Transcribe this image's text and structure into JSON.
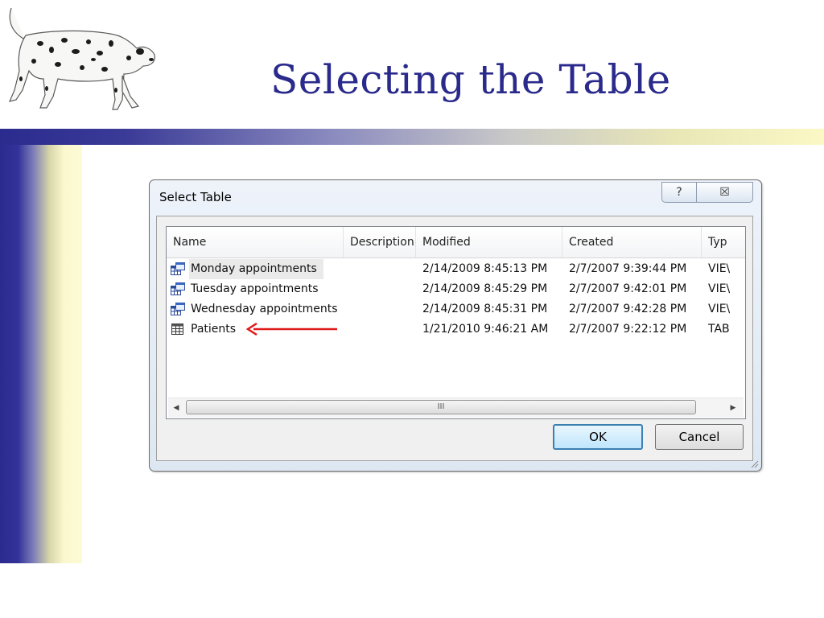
{
  "slide": {
    "title": "Selecting the Table"
  },
  "dialog": {
    "title": "Select Table",
    "help_glyph": "?",
    "close_glyph": "☒",
    "columns": [
      "Name",
      "Description",
      "Modified",
      "Created",
      "Typ"
    ],
    "rows": [
      {
        "name": "Monday appointments",
        "description": "",
        "modified": "2/14/2009 8:45:13 PM",
        "created": "2/7/2007 9:39:44 PM",
        "type": "VIE\\",
        "icon": "view-table-icon"
      },
      {
        "name": "Tuesday appointments",
        "description": "",
        "modified": "2/14/2009 8:45:29 PM",
        "created": "2/7/2007 9:42:01 PM",
        "type": "VIE\\",
        "icon": "view-table-icon"
      },
      {
        "name": "Wednesday appointments",
        "description": "",
        "modified": "2/14/2009 8:45:31 PM",
        "created": "2/7/2007 9:42:28 PM",
        "type": "VIE\\",
        "icon": "view-table-icon"
      },
      {
        "name": "Patients",
        "description": "",
        "modified": "1/21/2010 9:46:21 AM",
        "created": "2/7/2007 9:22:12 PM",
        "type": "TAB",
        "icon": "table-icon"
      }
    ],
    "scroll_grip": "III",
    "ok_label": "OK",
    "cancel_label": "Cancel"
  },
  "colors": {
    "title_text": "#2a2a8c",
    "annotation_arrow": "#e0191b",
    "ok_border": "#3c7fb1"
  }
}
